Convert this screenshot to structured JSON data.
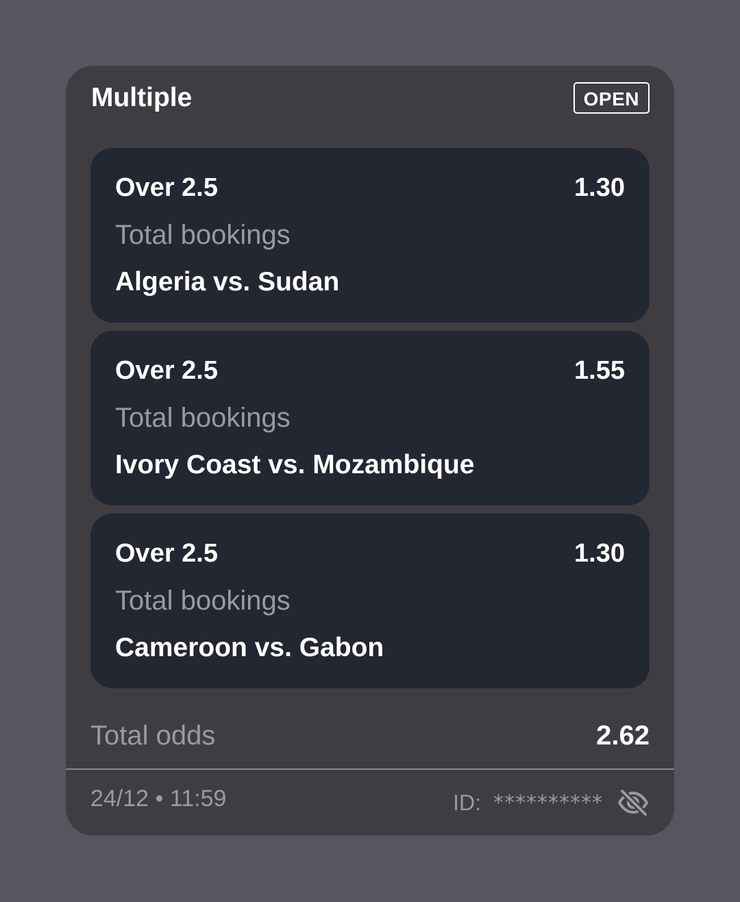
{
  "bet": {
    "title": "Multiple",
    "status": "OPEN"
  },
  "legs": [
    {
      "selection": "Over 2.5",
      "odds": "1.30",
      "market": "Total bookings",
      "match": "Algeria vs. Sudan"
    },
    {
      "selection": "Over 2.5",
      "odds": "1.55",
      "market": "Total bookings",
      "match": "Ivory Coast vs. Mozambique"
    },
    {
      "selection": "Over 2.5",
      "odds": "1.30",
      "market": "Total bookings",
      "match": "Cameroon vs. Gabon"
    }
  ],
  "summary": {
    "total_odds_label": "Total odds",
    "total_odds_value": "2.62"
  },
  "footer": {
    "datetime": "24/12 • 11:59",
    "id_label": "ID:",
    "id_value": "**********",
    "visibility_icon": "eye-off-icon"
  },
  "colors": {
    "background": "#57555f",
    "card": "#3f3d42",
    "leg_card": "#232732",
    "muted_text": "#9a9aa0",
    "text": "#ffffff"
  }
}
